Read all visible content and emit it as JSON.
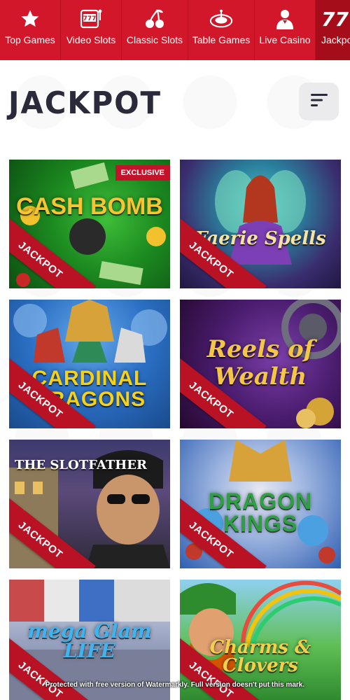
{
  "nav": {
    "items": [
      {
        "label": "Top Games",
        "icon": "star-icon"
      },
      {
        "label": "Video Slots",
        "icon": "slot-machine-icon"
      },
      {
        "label": "Classic Slots",
        "icon": "cherries-icon"
      },
      {
        "label": "Table Games",
        "icon": "roulette-icon"
      },
      {
        "label": "Live Casino",
        "icon": "dealer-icon"
      },
      {
        "label": "Jackpot",
        "icon": "jackpot-777-icon"
      }
    ]
  },
  "header": {
    "title": "JACKPOT",
    "menu_icon": "filter-menu-icon"
  },
  "games": [
    {
      "name": "CASH BOMB",
      "ribbon": "JACKPOT",
      "badge": "EXCLUSIVE"
    },
    {
      "name": "Faerie Spells",
      "ribbon": "JACKPOT"
    },
    {
      "name": "CARDINAL DRAGONS",
      "ribbon": "JACKPOT"
    },
    {
      "name": "Reels of Wealth",
      "ribbon": "JACKPOT"
    },
    {
      "name": "THE SLOTFATHER",
      "ribbon": "JACKPOT"
    },
    {
      "name": "DRAGON KINGS",
      "ribbon": "JACKPOT"
    },
    {
      "name": "mega Glam LIFE",
      "ribbon": "JACKPOT"
    },
    {
      "name": "Charms & Clovers",
      "ribbon": "JACKPOT"
    }
  ],
  "watermark": "Protected with free version of Watermarkly. Full version doesn't put this mark.",
  "colors": {
    "brand_red": "#d3172a",
    "nav_active": "#a50d1a",
    "ribbon_red": "#b81224",
    "title_dark": "#2a2a3a"
  }
}
